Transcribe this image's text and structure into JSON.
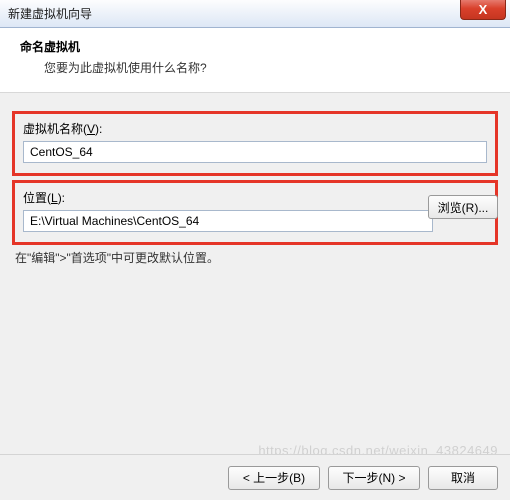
{
  "window": {
    "title": "新建虚拟机向导",
    "close_label": "X"
  },
  "header": {
    "title": "命名虚拟机",
    "subtitle": "您要为此虚拟机使用什么名称?"
  },
  "fields": {
    "name": {
      "label_prefix": "虚拟机名称(",
      "mnemonic": "V",
      "label_suffix": "):",
      "value": "CentOS_64"
    },
    "location": {
      "label_prefix": "位置(",
      "mnemonic": "L",
      "label_suffix": "):",
      "value": "E:\\Virtual Machines\\CentOS_64",
      "browse_label": "浏览(R)..."
    }
  },
  "hint": "在\"编辑\">\"首选项\"中可更改默认位置。",
  "footer": {
    "back": "< 上一步(B)",
    "next": "下一步(N) >",
    "cancel": "取消"
  },
  "watermark": "https://blog.csdn.net/weixin_43824649",
  "colors": {
    "highlight_border": "#e53528"
  }
}
